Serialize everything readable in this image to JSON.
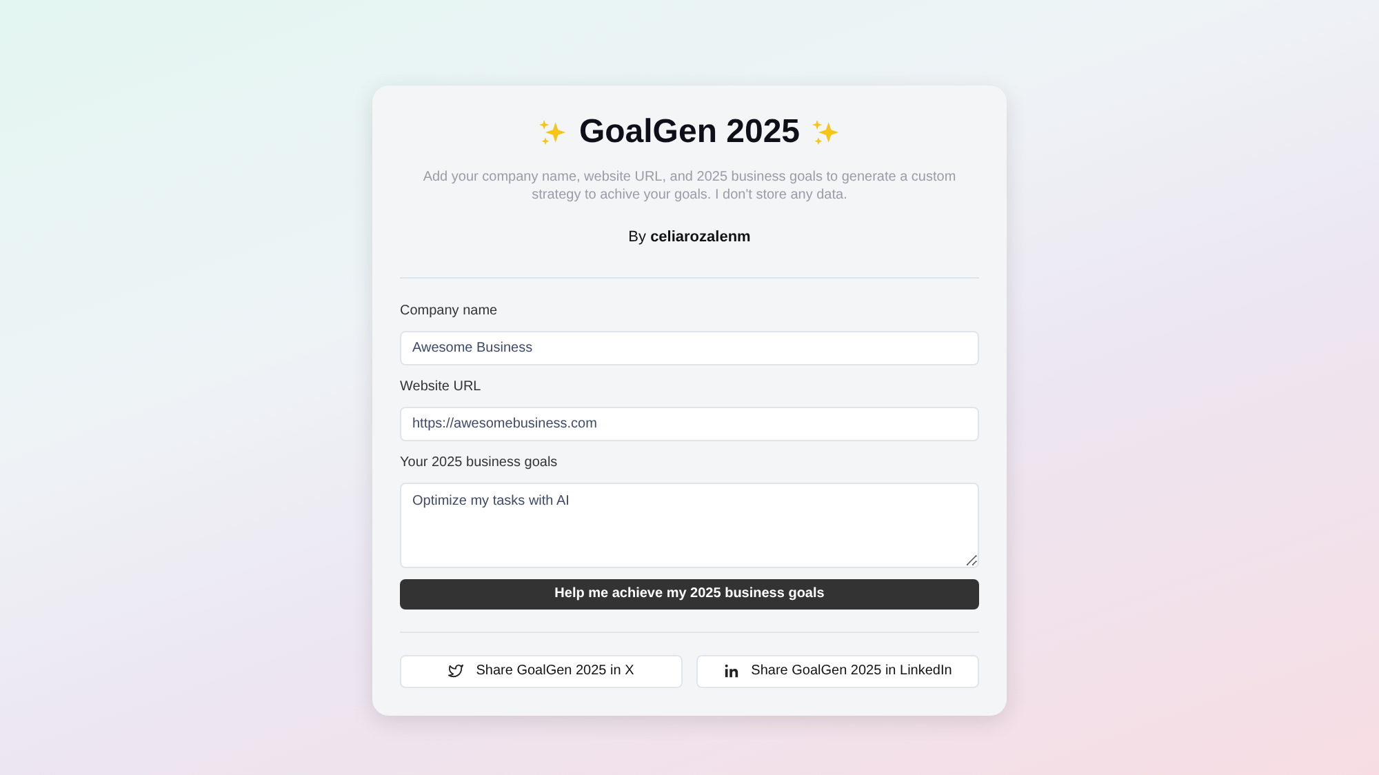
{
  "title": "GoalGen 2025",
  "description": "Add your company name, website URL, and 2025 business goals to generate a custom strategy to achive your goals. I don't store any data.",
  "byline": "By **celiarozalenm**",
  "fields": [
    {
      "kind": "input",
      "label": "Company name",
      "value": "Awesome Business"
    },
    {
      "kind": "input",
      "label": "Website URL",
      "value": "https://awesomebusiness.com"
    },
    {
      "kind": "textarea",
      "label": "Your 2025 business goals",
      "value": "Optimize my tasks with AI"
    }
  ],
  "submit_button": "Help me achieve my 2025 business goals",
  "share_buttons": [
    {
      "kind": "bird",
      "label": "Share GoalGen 2025 in X"
    },
    {
      "kind": "linkedin",
      "label": "Share GoalGen 2025 in LinkedIn"
    }
  ]
}
